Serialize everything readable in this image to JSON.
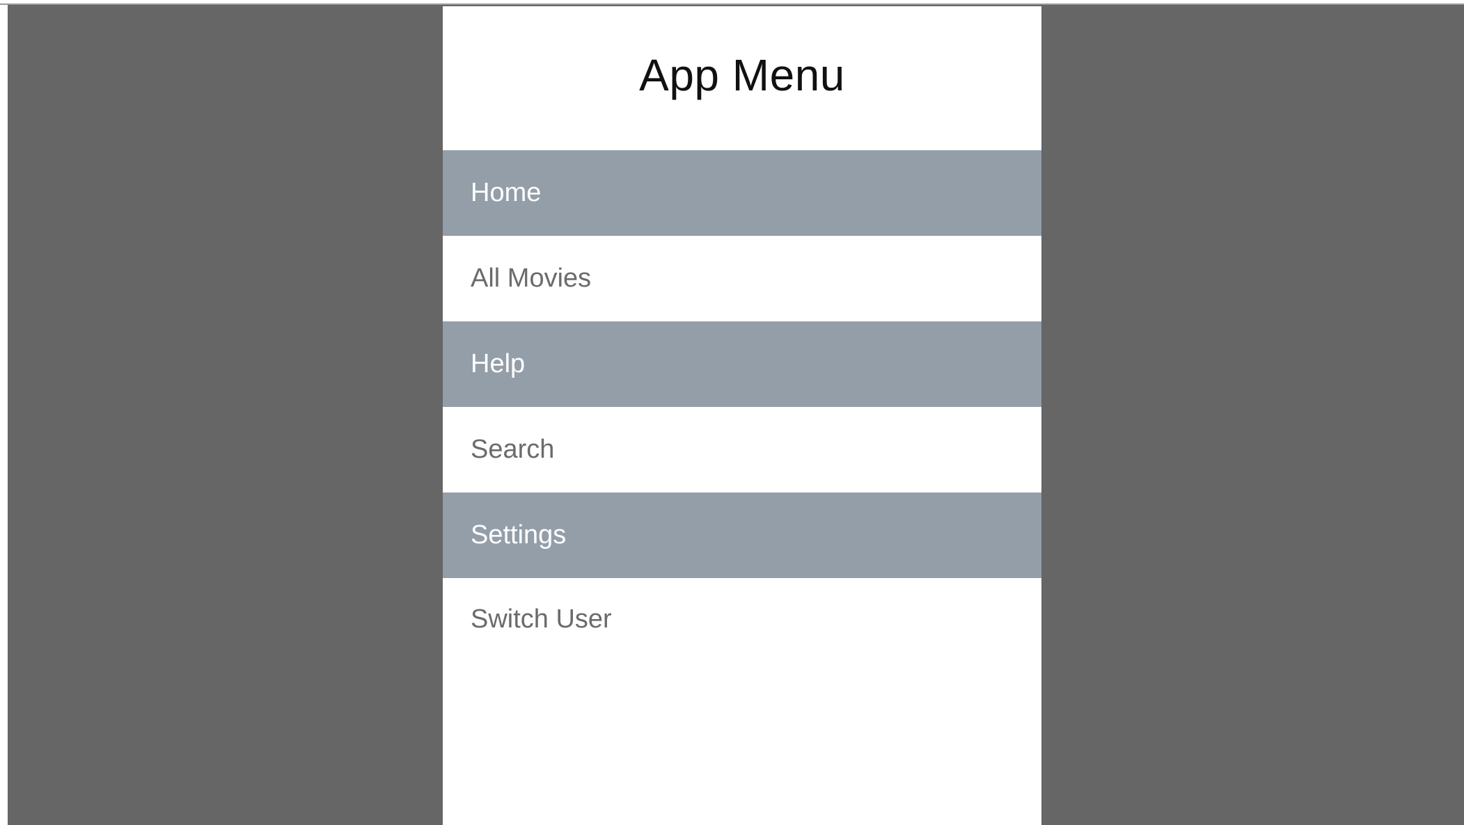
{
  "menu": {
    "title": "App Menu",
    "items": [
      {
        "label": "Home",
        "style": "shaded"
      },
      {
        "label": "All Movies",
        "style": "plain"
      },
      {
        "label": "Help",
        "style": "shaded"
      },
      {
        "label": "Search",
        "style": "plain"
      },
      {
        "label": "Settings",
        "style": "shaded"
      },
      {
        "label": "Switch User",
        "style": "plain"
      }
    ]
  },
  "colors": {
    "backdrop": "#666666",
    "panel": "#ffffff",
    "shaded_item": "#939ea9",
    "shaded_text": "#ffffff",
    "plain_text": "#6b6b6b",
    "title_text": "#111111"
  }
}
